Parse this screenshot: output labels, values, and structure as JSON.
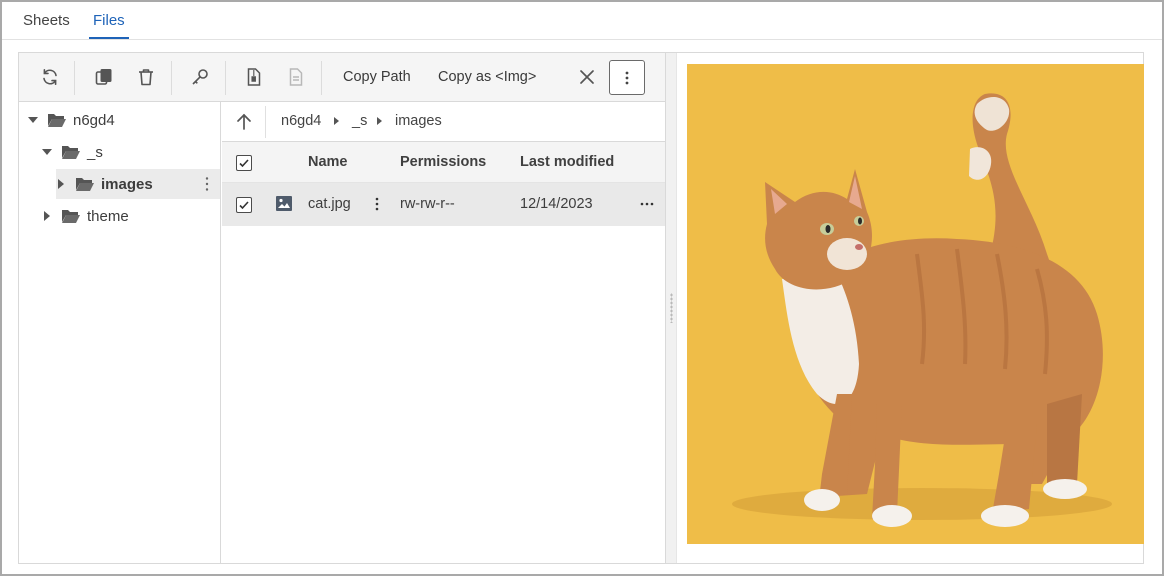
{
  "tabs": [
    {
      "label": "Sheets",
      "active": false
    },
    {
      "label": "Files",
      "active": true
    }
  ],
  "toolbar": {
    "icons": [
      "refresh-icon",
      "duplicate-icon",
      "trash-icon",
      "key-icon",
      "zip-file-icon",
      "document-icon"
    ],
    "copy_path_label": "Copy Path",
    "copy_img_label": "Copy as <Img>",
    "close_icon": "close-icon",
    "more_icon": "vertical-ellipsis-icon"
  },
  "tree": {
    "items": [
      {
        "label": "n6gd4",
        "expanded": true
      },
      {
        "label": "_s",
        "expanded": true
      },
      {
        "label": "images",
        "expanded": false,
        "selected": true
      },
      {
        "label": "theme",
        "expanded": false
      }
    ]
  },
  "breadcrumb": [
    "n6gd4",
    "_s",
    "images"
  ],
  "filelist": {
    "columns": [
      "Name",
      "Permissions",
      "Last modified"
    ],
    "rows": [
      {
        "name": "cat.jpg",
        "permissions": "rw-rw-r--",
        "modified": "12/14/2023",
        "checked": true
      }
    ],
    "header_checked": true
  },
  "preview": {
    "subject": "orange tabby cat on yellow background"
  },
  "colors": {
    "accent": "#1e63b8",
    "preview_bg": "#efbd48",
    "cat_fur": "#c9854b"
  }
}
